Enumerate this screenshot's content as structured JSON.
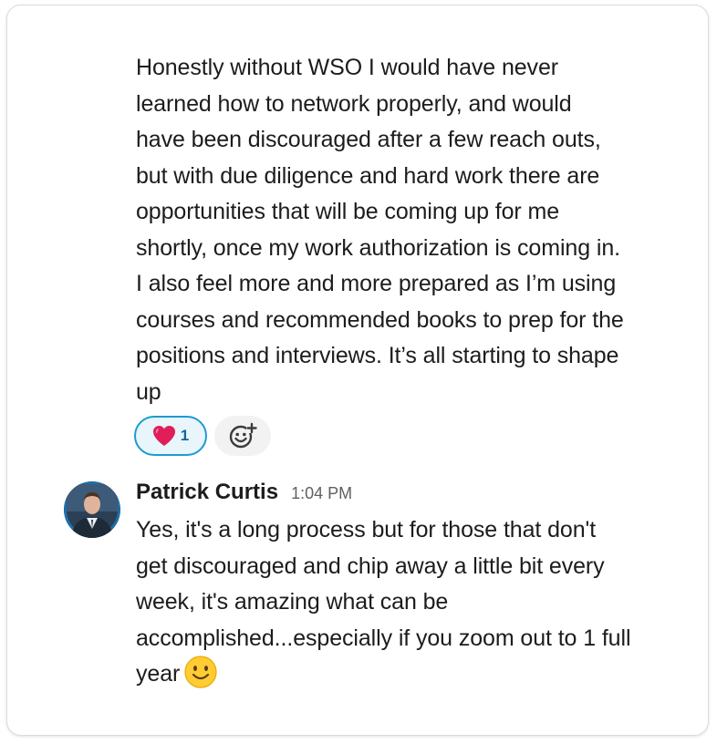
{
  "messages": [
    {
      "text": "Honestly without WSO I would have never\nlearned how to network properly, and would\nhave been discouraged after a few reach outs,\nbut with due diligence and hard work there are\nopportunities that will be coming up for me\nshortly, once my work authorization is coming in.\nI also feel more and more prepared as I’m using\ncourses and recommended books to prep for the\npositions and interviews. It’s all starting to shape\nup",
      "reactions": [
        {
          "emoji": "heart",
          "count": "1"
        }
      ]
    },
    {
      "author": "Patrick Curtis",
      "timestamp": "1:04 PM",
      "text": "Yes, it's a long process but for those that don't\nget discouraged and chip away a little bit every\nweek, it's amazing what can be\naccomplished...especially if you zoom out to 1 full\nyear",
      "trailing_emoji": "slightly-smiling-face"
    }
  ],
  "colors": {
    "reaction_border": "#1d9bd1",
    "reaction_bg": "#e8f5fa",
    "reaction_count": "#1264a3",
    "heart": "#e01e5a"
  }
}
